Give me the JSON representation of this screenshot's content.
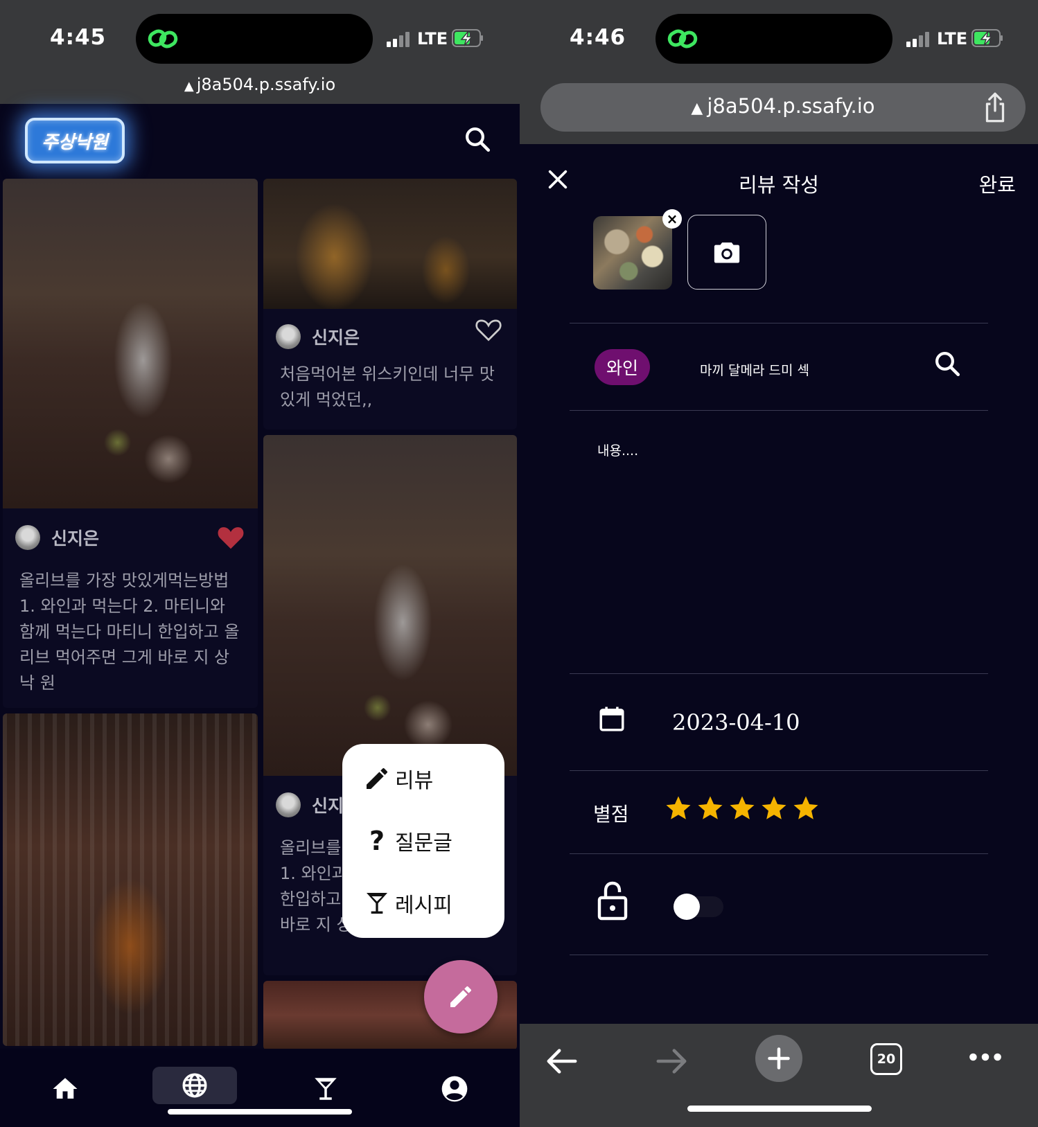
{
  "left_screen": {
    "status": {
      "time": "4:45",
      "network": "LTE"
    },
    "url": "j8a504.p.ssafy.io",
    "app": {
      "logo_text": "주상낙원",
      "cards": [
        {
          "username": "신지은",
          "liked": true,
          "text": "올리브를 가장 맛있게먹는방법 1. 와인과 먹는다 2. 마티니와 함께 먹는다 마티니 한입하고 올리브 먹어주면 그게 바로 지 상 낙 원"
        },
        {
          "username": "신지은",
          "liked": false,
          "text": "처음먹어본 위스키인데 너무 맛있게 먹었던,,"
        },
        {
          "username": "신지",
          "liked": false,
          "text": "올리브를 가장 맛있게먹는방법 1. 와인과 함께 먹는다 마티니 한입하고 올리브 먹어주면 그게 바로 지 상 낙 원"
        }
      ],
      "fab_menu": [
        {
          "label": "리뷰",
          "icon": "pencil-icon"
        },
        {
          "label": "질문글",
          "icon": "question-icon"
        },
        {
          "label": "레시피",
          "icon": "cocktail-glass-icon"
        }
      ],
      "bottom_nav": [
        {
          "name": "home",
          "icon": "home-icon",
          "active": false
        },
        {
          "name": "explore",
          "icon": "globe-icon",
          "active": true
        },
        {
          "name": "recipe",
          "icon": "cocktail-glass-icon",
          "active": false
        },
        {
          "name": "profile",
          "icon": "user-icon",
          "active": false
        }
      ],
      "colors": {
        "background": "#07061c",
        "fab": "#c56b9c",
        "heart": "#b3303f"
      }
    }
  },
  "right_screen": {
    "status": {
      "time": "4:46",
      "network": "LTE"
    },
    "url": "j8a504.p.ssafy.io",
    "form": {
      "title": "리뷰 작성",
      "done_label": "완료",
      "category_chip": "와인",
      "drink_name": "마끼 달메라 드미 섹",
      "content_placeholder": "내용....",
      "date": "2023-04-10",
      "rating_label": "별점",
      "rating": 5,
      "rating_max": 5,
      "public_toggle_on": false,
      "colors": {
        "chip": "#6f0f6f",
        "star": "#f5b400"
      }
    },
    "browser": {
      "tab_count": "20"
    }
  }
}
